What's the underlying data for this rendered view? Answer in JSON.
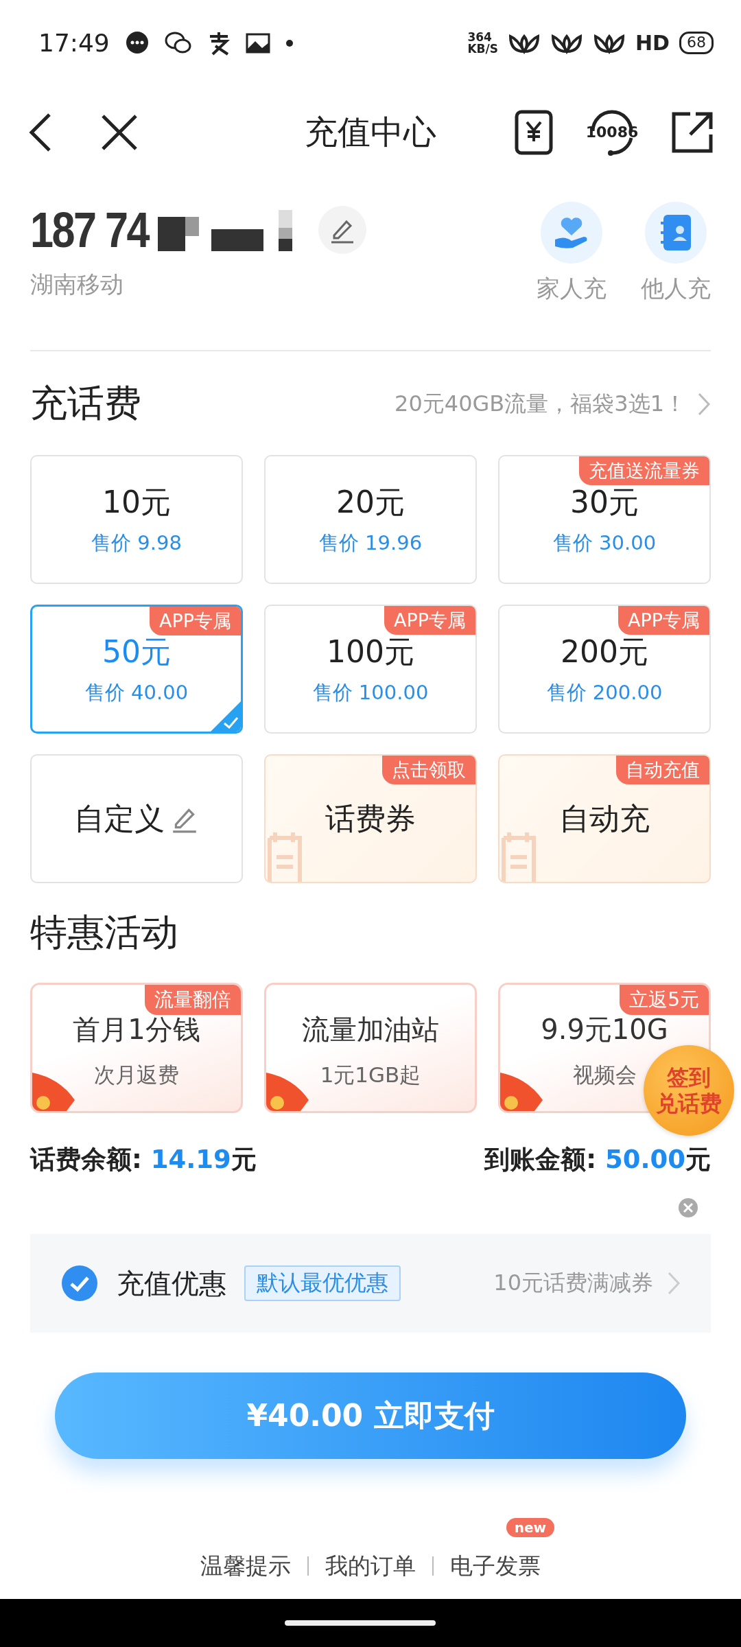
{
  "status_bar": {
    "time": "17:49",
    "speed_value": "364",
    "speed_unit": "KB/S",
    "hd": "HD",
    "battery": "68"
  },
  "nav": {
    "title": "充值中心",
    "hotline": "10086"
  },
  "account": {
    "number": "187 74",
    "carrier": "湖南移动",
    "actions": [
      {
        "label": "家人充",
        "kind": "family"
      },
      {
        "label": "他人充",
        "kind": "contacts"
      }
    ]
  },
  "recharge": {
    "title": "充话费",
    "promo": "20元40GB流量，福袋3选1！",
    "options": [
      {
        "kind": "amount",
        "amount": "10元",
        "price": "售价 9.98",
        "selected": false
      },
      {
        "kind": "amount",
        "amount": "20元",
        "price": "售价 19.96",
        "selected": false
      },
      {
        "kind": "amount",
        "amount": "30元",
        "price": "售价 30.00",
        "tag": "充值送流量券",
        "selected": false
      },
      {
        "kind": "amount",
        "amount": "50元",
        "price": "售价 40.00",
        "tag": "APP专属",
        "selected": true
      },
      {
        "kind": "amount",
        "amount": "100元",
        "price": "售价 100.00",
        "tag": "APP专属",
        "selected": false
      },
      {
        "kind": "amount",
        "amount": "200元",
        "price": "售价 200.00",
        "tag": "APP专属",
        "selected": false
      },
      {
        "kind": "custom",
        "amount": "自定义",
        "selected": false
      },
      {
        "kind": "voucher",
        "amount": "话费券",
        "tag": "点击领取",
        "selected": false
      },
      {
        "kind": "voucher",
        "amount": "自动充",
        "tag": "自动充值",
        "selected": false
      }
    ]
  },
  "activities": {
    "title": "特惠活动",
    "items": [
      {
        "title": "首月1分钱",
        "subtitle": "次月返费",
        "tag": "流量翻倍"
      },
      {
        "title": "流量加油站",
        "subtitle": "1元1GB起"
      },
      {
        "title": "9.9元10G",
        "subtitle": "视频会",
        "tag": "立返5元"
      }
    ]
  },
  "floating_badge": {
    "lines": [
      "签到",
      "兑话费"
    ]
  },
  "balance": {
    "label": "话费余额:",
    "value": "14.19",
    "unit": "元"
  },
  "arrival": {
    "label": "到账金额:",
    "value": "50.00",
    "unit": "元"
  },
  "discount": {
    "checked": true,
    "label": "充值优惠",
    "tag": "默认最优优惠",
    "value": "10元话费满减券"
  },
  "pay_button": {
    "label": "¥40.00 立即支付"
  },
  "footer": {
    "links": [
      {
        "label": "温馨提示"
      },
      {
        "label": "我的订单"
      },
      {
        "label": "电子发票",
        "badge": "new"
      }
    ]
  }
}
